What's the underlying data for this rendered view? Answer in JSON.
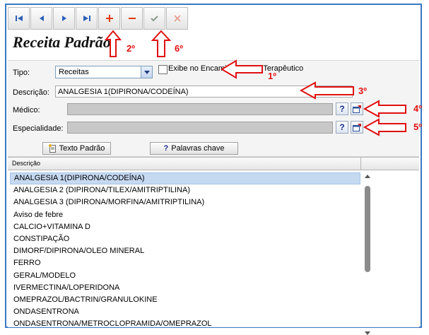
{
  "window": {
    "title": "Receita Padrão"
  },
  "toolbar": {
    "first_icon": "first-record-icon",
    "prev_icon": "previous-record-icon",
    "next_icon": "next-record-icon",
    "last_icon": "last-record-icon",
    "add_icon": "plus-icon",
    "remove_icon": "minus-icon",
    "confirm_icon": "check-icon",
    "cancel_icon": "x-icon"
  },
  "form": {
    "tipo_label": "Tipo:",
    "tipo_value": "Receitas",
    "exibe_label": "Exibe no Encaminhamento Terapêutico",
    "descricao_label": "Descrição:",
    "descricao_value": "ANALGESIA 1(DIPIRONA/CODEÍNA)",
    "medico_label": "Médico:",
    "especialidade_label": "Especialidade:",
    "help_glyph": "?",
    "texto_padrao_label": "Texto Padrão",
    "palavras_chave_label": "Palavras chave"
  },
  "grid": {
    "column_header": "Descrição",
    "rows": [
      "ANALGESIA 1(DIPIRONA/CODEÍNA)",
      "ANALGESIA 2 (DIPIRONA/TILEX/AMITRIPTILINA)",
      "ANALGESIA 3 (DIPIRONA/MORFINA/AMITRIPTILINA)",
      "Aviso de febre",
      "CALCIO+VITAMINA D",
      "CONSTIPAÇÃO",
      "DIMORF/DIPIRONA/OLEO MINERAL",
      "FERRO",
      "GERAL/MODELO",
      "IVERMECTINA/LOPERIDONA",
      "OMEPRAZOL/BACTRIN/GRANULOKINE",
      "ONDASENTRONA",
      "ONDASENTRONA/METROCLOPRAMIDA/OMEPRAZOL"
    ],
    "selected_index": 0
  },
  "annotations": {
    "a1": "1º",
    "a2": "2º",
    "a3": "3º",
    "a4": "4º",
    "a5": "5º",
    "a6": "6º"
  },
  "colors": {
    "accent": "#3a78c2",
    "annotation": "#e01010",
    "selection": "#c5d9f1"
  }
}
